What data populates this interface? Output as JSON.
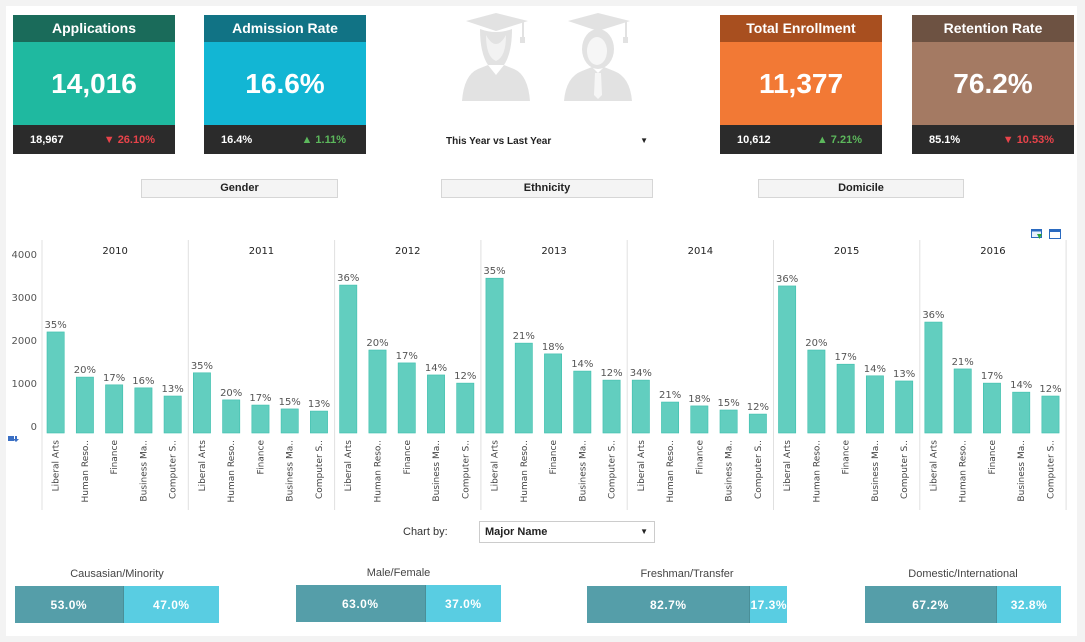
{
  "kpis": [
    {
      "title": "Applications",
      "value": "14,016",
      "previous": "18,967",
      "change": "26.10%",
      "direction": "down",
      "head_color": "#1a6b5a",
      "body_color": "#1fb9a0"
    },
    {
      "title": "Admission Rate",
      "value": "16.6%",
      "previous": "16.4%",
      "change": "1.11%",
      "direction": "up",
      "head_color": "#117385",
      "body_color": "#12b6d4"
    },
    {
      "title": "Total Enrollment",
      "value": "11,377",
      "previous": "10,612",
      "change": "7.21%",
      "direction": "up",
      "head_color": "#a84f1f",
      "body_color": "#f27935"
    },
    {
      "title": "Retention Rate",
      "value": "76.2%",
      "previous": "85.1%",
      "change": "10.53%",
      "direction": "down",
      "head_color": "#6d5242",
      "body_color": "#a47a63"
    }
  ],
  "arrows": {
    "up": "▲",
    "down": "▼"
  },
  "period_selector": {
    "value": "This Year vs Last Year",
    "arrow": "▼"
  },
  "segments": [
    "Gender",
    "Ethnicity",
    "Domicile"
  ],
  "icons": {
    "female_graduate": "female-graduate-icon",
    "male_graduate": "male-graduate-icon",
    "export": "export-icon",
    "maximize": "maximize-icon",
    "sort": "sort-icon"
  },
  "chart_by": {
    "label": "Chart by:",
    "value": "Major Name",
    "arrow": "▼"
  },
  "ratios": [
    {
      "title": "Causasian/Minority",
      "left": 53.0,
      "right": 47.0,
      "left_label": "53.0%",
      "right_label": "47.0%"
    },
    {
      "title": "Male/Female",
      "left": 63.0,
      "right": 37.0,
      "left_label": "63.0%",
      "right_label": "37.0%"
    },
    {
      "title": "Freshman/Transfer",
      "left": 82.7,
      "right": 17.3,
      "left_label": "82.7%",
      "right_label": "17.3%"
    },
    {
      "title": "Domestic/International",
      "left": 67.2,
      "right": 32.8,
      "left_label": "67.2%",
      "right_label": "32.8%"
    }
  ],
  "chart_data": {
    "type": "bar",
    "title": "",
    "xlabel": "",
    "ylabel": "",
    "ylim": [
      0,
      4000
    ],
    "yticks": [
      0,
      1000,
      2000,
      3000,
      4000
    ],
    "grid": false,
    "bar_color": "#62cebf",
    "categories": [
      "Liberal Arts",
      "Human Reso..",
      "Finance",
      "Business Ma..",
      "Computer S.."
    ],
    "panels": [
      {
        "year": "2010",
        "values": [
          2350,
          1300,
          1120,
          1050,
          860
        ],
        "labels": [
          "35%",
          "20%",
          "17%",
          "16%",
          "13%"
        ]
      },
      {
        "year": "2011",
        "values": [
          1400,
          770,
          650,
          560,
          510
        ],
        "labels": [
          "35%",
          "20%",
          "17%",
          "15%",
          "13%"
        ]
      },
      {
        "year": "2012",
        "values": [
          3440,
          1930,
          1630,
          1350,
          1160
        ],
        "labels": [
          "36%",
          "20%",
          "17%",
          "14%",
          "12%"
        ]
      },
      {
        "year": "2013",
        "values": [
          3600,
          2090,
          1840,
          1440,
          1230
        ],
        "labels": [
          "35%",
          "21%",
          "18%",
          "14%",
          "12%"
        ]
      },
      {
        "year": "2014",
        "values": [
          1230,
          720,
          630,
          535,
          440
        ],
        "labels": [
          "34%",
          "21%",
          "18%",
          "15%",
          "12%"
        ]
      },
      {
        "year": "2015",
        "values": [
          3420,
          1930,
          1600,
          1330,
          1210
        ],
        "labels": [
          "36%",
          "20%",
          "17%",
          "14%",
          "13%"
        ]
      },
      {
        "year": "2016",
        "values": [
          2580,
          1490,
          1160,
          950,
          860
        ],
        "labels": [
          "36%",
          "21%",
          "17%",
          "14%",
          "12%"
        ]
      }
    ]
  }
}
